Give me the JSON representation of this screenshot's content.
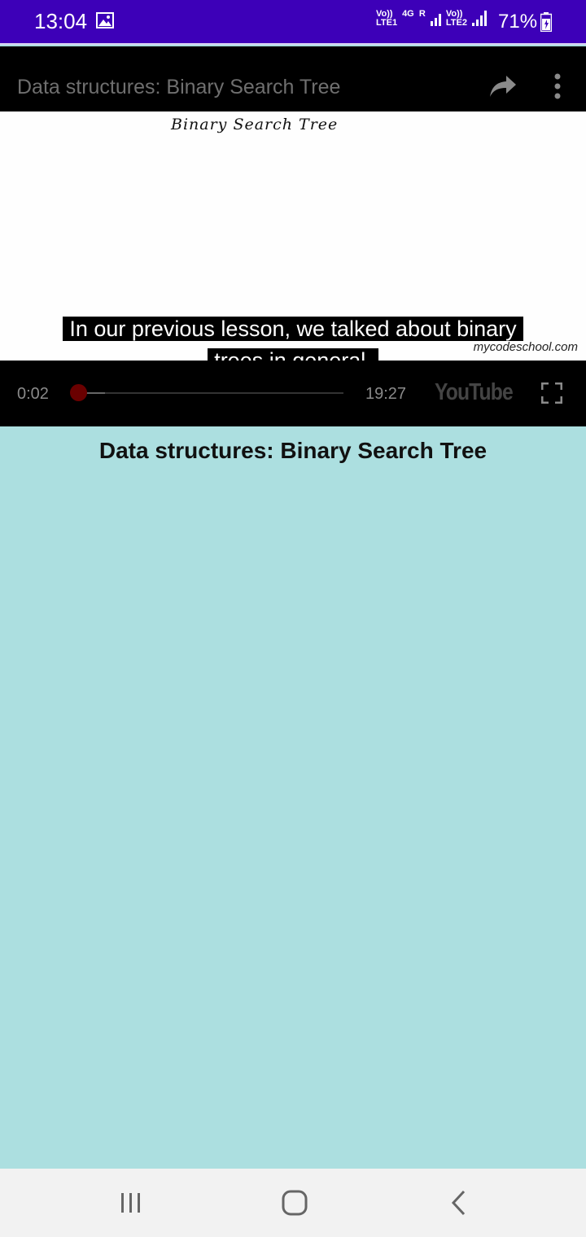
{
  "status_bar": {
    "time": "13:04",
    "sim1_label": "Vo)) LTE1",
    "network_label": "4G",
    "roaming_label": "R",
    "sim2_label": "Vo)) LTE2",
    "battery_percent": "71%",
    "icons": [
      "image-icon",
      "signal-icon",
      "battery-icon"
    ]
  },
  "video": {
    "title": "Data structures: Binary Search Tree",
    "board_text": "Binary Search Tree",
    "caption_line1": "In our previous lesson, we talked about binary",
    "caption_line2": "trees in general.",
    "watermark": "mycodeschool.com",
    "current_time": "0:02",
    "total_time": "19:27",
    "progress_fraction": 0.0017,
    "brand_logo": "YouTube",
    "icons": [
      "share-icon",
      "more-icon",
      "fullscreen-icon"
    ]
  },
  "page": {
    "heading": "Data structures: Binary Search Tree",
    "background_color": "#acdfe0"
  },
  "nav_bar": {
    "icons": [
      "recents-icon",
      "home-icon",
      "back-icon"
    ]
  }
}
